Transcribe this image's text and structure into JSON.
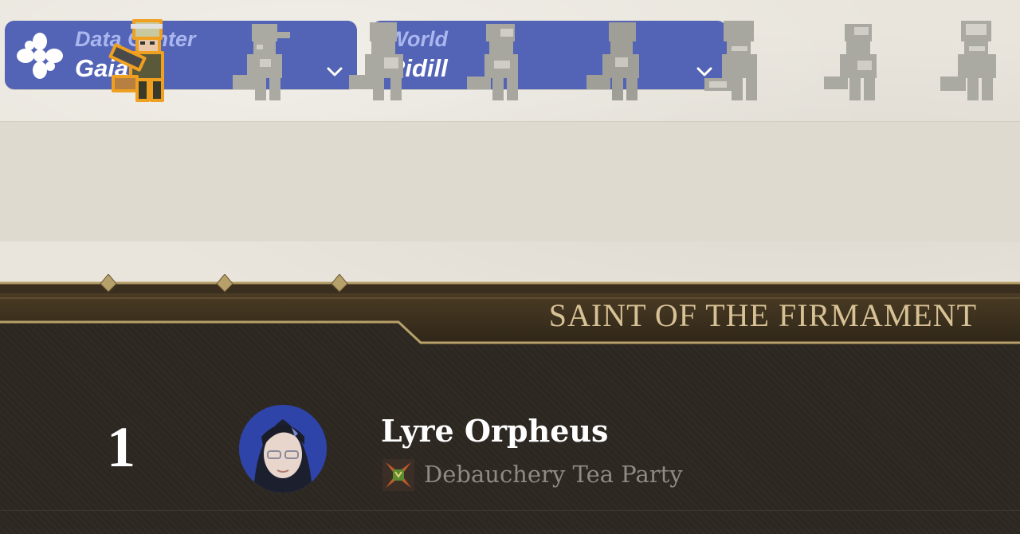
{
  "data_center": {
    "label": "Data Center",
    "value": "Gaia",
    "icon": "flower-icon"
  },
  "world": {
    "label": "World",
    "value": "Ridill"
  },
  "jobs": [
    {
      "name": "machinist",
      "selected": true
    },
    {
      "name": "job-2",
      "selected": false
    },
    {
      "name": "job-3",
      "selected": false
    },
    {
      "name": "job-4",
      "selected": false
    },
    {
      "name": "job-5",
      "selected": false
    },
    {
      "name": "job-6",
      "selected": false
    },
    {
      "name": "job-7",
      "selected": false
    },
    {
      "name": "job-8",
      "selected": false
    }
  ],
  "banner": {
    "title": "SAINT OF THE FIRMAMENT"
  },
  "leaderboard": [
    {
      "rank": "1",
      "name": "Lyre Orpheus",
      "free_company": "Debauchery Tea Party"
    }
  ],
  "colors": {
    "selector_bg": "#5363b5",
    "selector_label": "#aab6ee",
    "panel_bg": "#2d2722",
    "banner_text": "#d7c195",
    "selected_job_outline": "#f0a020"
  }
}
